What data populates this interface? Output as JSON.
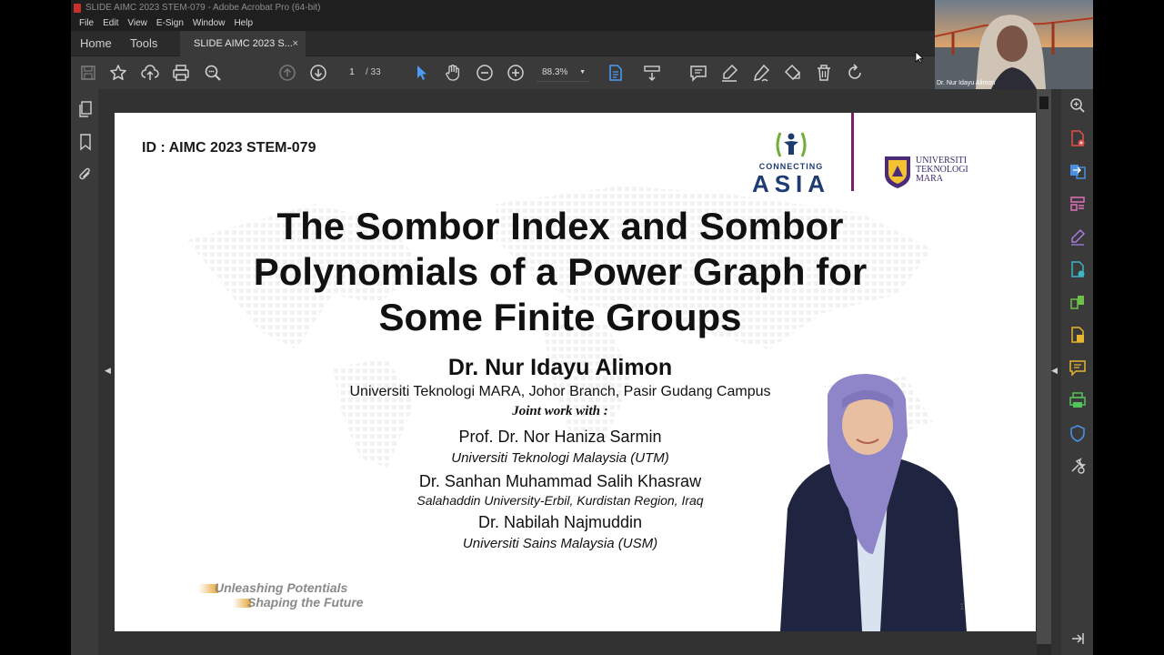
{
  "window": {
    "title": "SLIDE AIMC 2023 STEM-079 - Adobe Acrobat Pro (64-bit)",
    "menu": [
      "File",
      "Edit",
      "View",
      "E-Sign",
      "Window",
      "Help"
    ]
  },
  "tabs": {
    "home": "Home",
    "tools": "Tools",
    "document": "SLIDE AIMC 2023 S...",
    "close": "×"
  },
  "toolbar": {
    "current_page": "1",
    "total_pages": "/ 33",
    "zoom": "88.3%",
    "icons": [
      "save-icon",
      "star-icon",
      "cloud-upload-icon",
      "print-icon",
      "find-icon",
      "page-up-icon",
      "page-down-icon",
      "select-pointer-icon",
      "hand-icon",
      "zoom-out-icon",
      "zoom-in-icon",
      "page-fit-icon",
      "scroll-mode-icon",
      "comment-icon",
      "highlight-icon",
      "sign-icon",
      "stamp-icon",
      "delete-icon",
      "rotate-icon"
    ]
  },
  "slide": {
    "id_text": "ID : AIMC 2023 STEM-079",
    "logo_connecting": "CONNECTING",
    "logo_asia": "ASIA",
    "logo_uitm": [
      "UNIVERSITI",
      "TEKNOLOGI",
      "MARA"
    ],
    "title_lines": [
      "The Sombor Index and Sombor",
      "Polynomials of a Power Graph for",
      "Some Finite Groups"
    ],
    "author": "Dr. Nur Idayu Alimon",
    "author_affiliation": "Universiti Teknologi MARA, Johor Branch, Pasir Gudang Campus",
    "joint_work": "Joint work with :",
    "coauthors": [
      {
        "name": "Prof. Dr. Nor Haniza Sarmin",
        "affiliation": "Universiti Teknologi Malaysia (UTM)"
      },
      {
        "name": "Dr. Sanhan Muhammad Salih Khasraw",
        "affiliation": "Salahaddin University-Erbil, Kurdistan Region, Iraq"
      },
      {
        "name": "Dr. Nabilah Najmuddin",
        "affiliation": "Universiti Sains Malaysia (USM)"
      }
    ],
    "tagline_1": "Unleashing Potentials",
    "tagline_2": "Shaping the Future",
    "page_number": "1"
  },
  "webcam": {
    "participant_name": "Dr. Nur Idayu Alimon"
  },
  "colors": {
    "app_bg": "#323232",
    "toolbar": "#3a3a3a",
    "accent_blue": "#4a9cf5",
    "asia_blue": "#1e3c72",
    "uitm_purple": "#7a1f6a"
  }
}
